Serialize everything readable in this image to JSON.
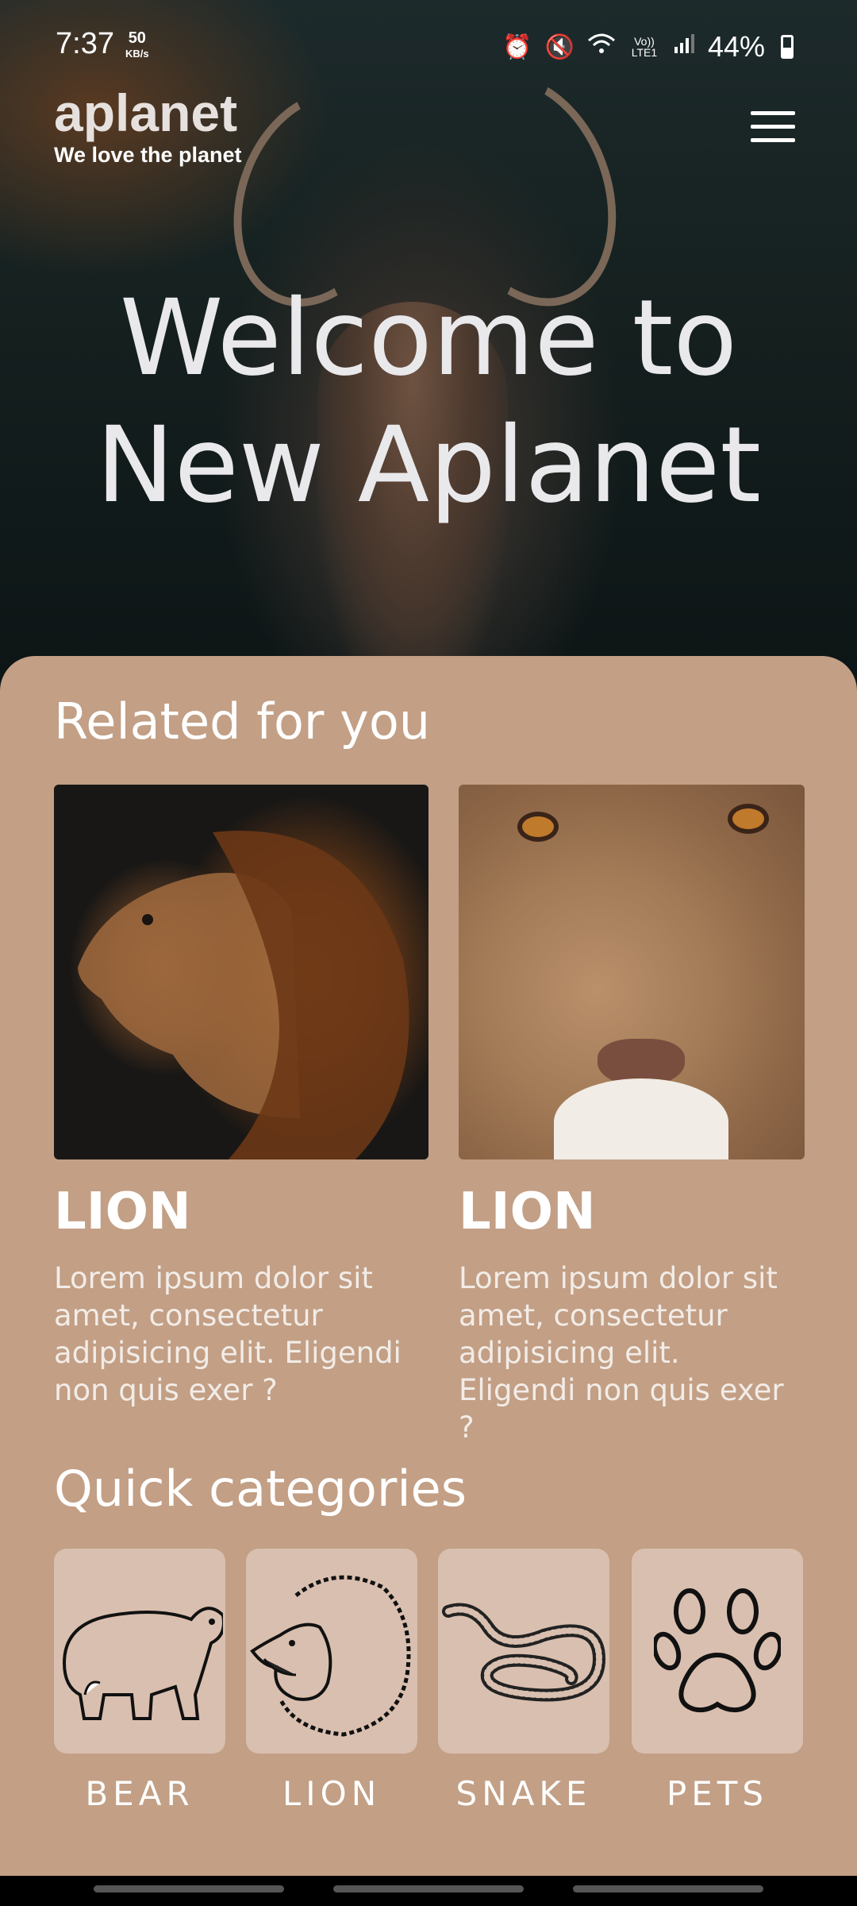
{
  "status_bar": {
    "time": "7:37",
    "speed_value": "50",
    "speed_unit": "KB/s",
    "volte_label": "Vo)) LTE1",
    "battery": "44%"
  },
  "header": {
    "brand_name": "aplanet",
    "tagline": "We love the planet"
  },
  "hero": {
    "title_line1": "Welcome to",
    "title_line2": "New Aplanet"
  },
  "related": {
    "title": "Related for you",
    "cards": [
      {
        "title": "LION",
        "description": "Lorem ipsum dolor sit amet, consectetur adipisicing elit. Eligendi non quis exer ?"
      },
      {
        "title": "LION",
        "description": "Lorem ipsum dolor sit amet, consectetur adipisicing elit. Eligendi non quis exer ?"
      }
    ]
  },
  "categories": {
    "title": "Quick categories",
    "items": [
      {
        "label": "BEAR",
        "icon": "bear-icon"
      },
      {
        "label": "LION",
        "icon": "lion-icon"
      },
      {
        "label": "SNAKE",
        "icon": "snake-icon"
      },
      {
        "label": "PETS",
        "icon": "paw-icon"
      }
    ]
  },
  "colors": {
    "sheet_background": "#c29f85",
    "category_tile": "#d9bfaf",
    "text_light": "#ffffff"
  }
}
